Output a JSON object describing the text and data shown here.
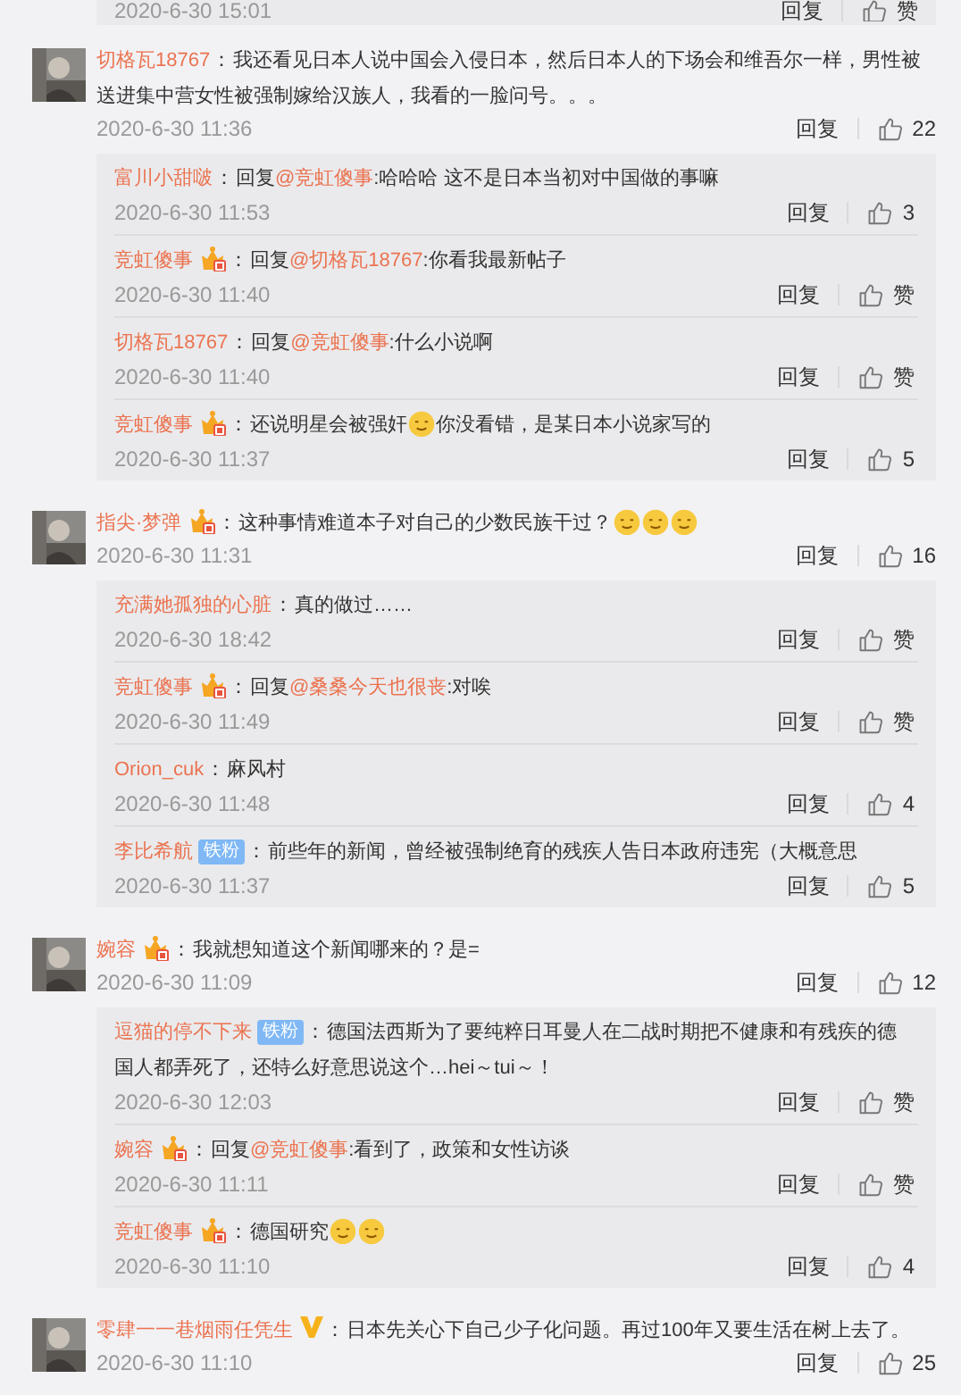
{
  "top_partial": {
    "time": "2020-6-30 15:01",
    "reply": "回复",
    "likes": "赞"
  },
  "comments": [
    {
      "avatar": {
        "kind": "picture"
      },
      "name": "切格瓦18767",
      "separator": "：",
      "parts": [
        {
          "kind": "plain",
          "text": "我还看见日本人说中国会入侵日本，然后日本人的下场会和维吾尔一样，男性被送进集中营女性被强制嫁给汉族人，我看的一脸问号。。。"
        }
      ],
      "time": "2020-6-30 11:36",
      "reply": "回复",
      "likes": "22",
      "replies": [
        {
          "name": "富川小甜啵",
          "separator": "：",
          "parts": [
            {
              "kind": "plain",
              "text": "回复"
            },
            {
              "kind": "mention",
              "text": "@竞虹傻事"
            },
            {
              "kind": "plain",
              "text": ":哈哈哈 这不是日本当初对中国做的事嘛"
            }
          ],
          "time": "2020-6-30 11:53",
          "reply": "回复",
          "likes": "3"
        },
        {
          "name": "竞虹傻事",
          "badge": {
            "kind": "vip"
          },
          "separator": "：",
          "parts": [
            {
              "kind": "plain",
              "text": "回复"
            },
            {
              "kind": "mention",
              "text": "@切格瓦18767"
            },
            {
              "kind": "plain",
              "text": ":你看我最新帖子"
            }
          ],
          "time": "2020-6-30 11:40",
          "reply": "回复",
          "likes": "赞"
        },
        {
          "name": "切格瓦18767",
          "separator": "：",
          "parts": [
            {
              "kind": "plain",
              "text": "回复"
            },
            {
              "kind": "mention",
              "text": "@竞虹傻事"
            },
            {
              "kind": "plain",
              "text": ":什么小说啊"
            }
          ],
          "time": "2020-6-30 11:40",
          "reply": "回复",
          "likes": "赞"
        },
        {
          "name": "竞虹傻事",
          "badge": {
            "kind": "vip"
          },
          "separator": "：",
          "parts": [
            {
              "kind": "plain",
              "text": "还说明星会被强奸"
            },
            {
              "kind": "emoji"
            },
            {
              "kind": "plain",
              "text": "你没看错，是某日本小说家写的"
            }
          ],
          "time": "2020-6-30 11:37",
          "reply": "回复",
          "likes": "5"
        }
      ]
    },
    {
      "avatar": {
        "kind": "picture"
      },
      "name": "指尖·梦弹",
      "badge": {
        "kind": "vip"
      },
      "separator": "：",
      "parts": [
        {
          "kind": "plain",
          "text": "这种事情难道本子对自己的少数民族干过？"
        },
        {
          "kind": "emoji"
        },
        {
          "kind": "emoji"
        },
        {
          "kind": "emoji"
        }
      ],
      "time": "2020-6-30 11:31",
      "reply": "回复",
      "likes": "16",
      "replies": [
        {
          "name": "充满她孤独的心脏",
          "separator": "：",
          "parts": [
            {
              "kind": "plain",
              "text": "真的做过……"
            }
          ],
          "time": "2020-6-30 18:42",
          "reply": "回复",
          "likes": "赞"
        },
        {
          "name": "竞虹傻事",
          "badge": {
            "kind": "vip"
          },
          "separator": "：",
          "parts": [
            {
              "kind": "plain",
              "text": "回复"
            },
            {
              "kind": "mention",
              "text": "@桑桑今天也很丧"
            },
            {
              "kind": "plain",
              "text": ":对唉"
            }
          ],
          "time": "2020-6-30 11:49",
          "reply": "回复",
          "likes": "赞"
        },
        {
          "name": "Orion_cuk",
          "separator": "：",
          "parts": [
            {
              "kind": "plain",
              "text": "麻风村"
            }
          ],
          "time": "2020-6-30 11:48",
          "reply": "回复",
          "likes": "4"
        },
        {
          "name": "李比希航",
          "badge": {
            "kind": "fan",
            "text": "铁粉"
          },
          "separator": "：",
          "parts": [
            {
              "kind": "plain",
              "text": "前些年的新闻，曾经被强制绝育的残疾人告日本政府违宪（大概意思"
            }
          ],
          "time": "2020-6-30 11:37",
          "reply": "回复",
          "likes": "5"
        }
      ]
    },
    {
      "avatar": {
        "kind": "picture"
      },
      "name": "婉容",
      "badge": {
        "kind": "vip"
      },
      "separator": "：",
      "parts": [
        {
          "kind": "plain",
          "text": "我就想知道这个新闻哪来的？是="
        }
      ],
      "time": "2020-6-30 11:09",
      "reply": "回复",
      "likes": "12",
      "replies": [
        {
          "name": "逗猫的停不下来",
          "badge": {
            "kind": "fan",
            "text": "铁粉"
          },
          "separator": "：",
          "parts": [
            {
              "kind": "plain",
              "text": "德国法西斯为了要纯粹日耳曼人在二战时期把不健康和有残疾的德国人都弄死了，还特么好意思说这个…hei～tui～！"
            }
          ],
          "time": "2020-6-30 12:03",
          "reply": "回复",
          "likes": "赞"
        },
        {
          "name": "婉容",
          "badge": {
            "kind": "vip"
          },
          "separator": "：",
          "parts": [
            {
              "kind": "plain",
              "text": "回复"
            },
            {
              "kind": "mention",
              "text": "@竞虹傻事"
            },
            {
              "kind": "plain",
              "text": ":看到了，政策和女性访谈"
            }
          ],
          "time": "2020-6-30 11:11",
          "reply": "回复",
          "likes": "赞"
        },
        {
          "name": "竞虹傻事",
          "badge": {
            "kind": "vip"
          },
          "separator": "：",
          "parts": [
            {
              "kind": "plain",
              "text": "德国研究"
            },
            {
              "kind": "emoji"
            },
            {
              "kind": "emoji"
            }
          ],
          "time": "2020-6-30 11:10",
          "reply": "回复",
          "likes": "4"
        }
      ]
    },
    {
      "avatar": {
        "kind": "picture"
      },
      "name": "零肆一一巷烟雨任凭生",
      "badge": {
        "kind": "verified"
      },
      "separator": "：",
      "parts": [
        {
          "kind": "plain",
          "text": "日本先关心下自己少子化问题。再过100年又要生活在树上去了。"
        }
      ],
      "time": "2020-6-30 11:10",
      "reply": "回复",
      "likes": "25"
    }
  ]
}
